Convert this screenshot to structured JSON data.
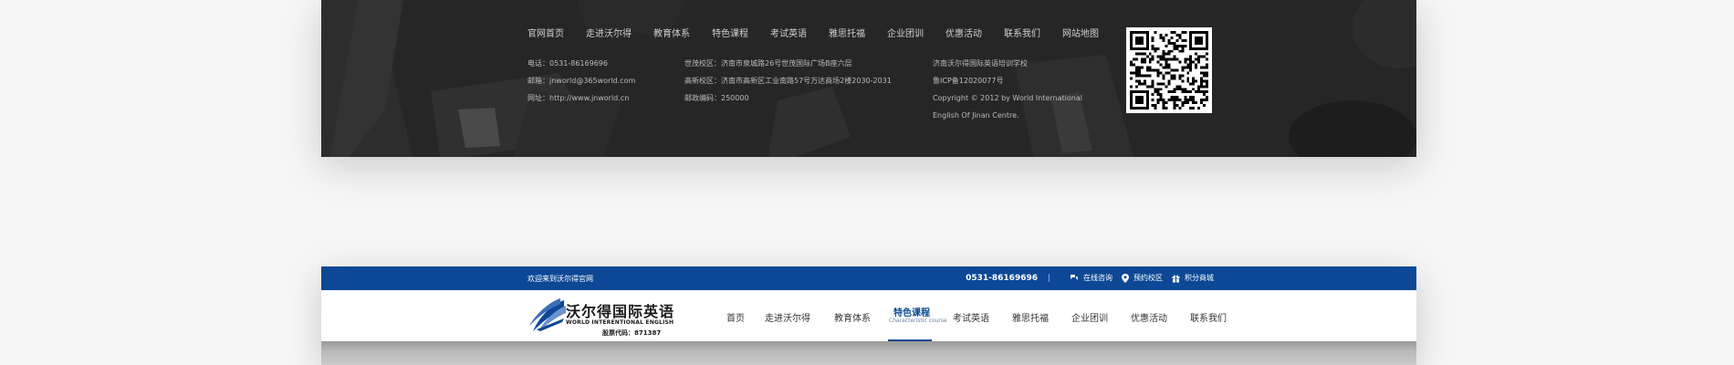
{
  "footer": {
    "nav": [
      "官网首页",
      "走进沃尔得",
      "教育体系",
      "特色课程",
      "考试英语",
      "雅思托福",
      "企业团训",
      "优惠活动",
      "联系我们",
      "网站地图"
    ],
    "contact": {
      "phone": "电话：0531-86169696",
      "email": "邮箱：jnworld@365world.com",
      "website": "网址：http://www.jnworld.cn"
    },
    "campus": {
      "shimao": "世茂校区：济南市泉城路26号世茂国际广场B座六层",
      "gaoxin": "高新校区：济南市高新区工业南路57号万达商场2楼2030-2031",
      "postcode": "邮政编码：250000"
    },
    "company": {
      "name": "济南沃尔得国际英语培训学校",
      "icp": "鲁ICP备12020077号",
      "copyright_1": "Copyright © 2012 by World International",
      "copyright_2": "English Of Jinan Centre."
    }
  },
  "header": {
    "topbar": {
      "welcome": "欢迎来到沃尔得官网",
      "phone": "0531-86169696",
      "links": [
        "在线咨询",
        "预约校区",
        "积分商城"
      ]
    },
    "logo": {
      "brand": "沃尔得国际英语",
      "sub": "WORLD INTERENTIONAL ENGLISH",
      "stock": "股票代码：871387"
    },
    "menu": [
      {
        "label": "首页"
      },
      {
        "label": "走进沃尔得"
      },
      {
        "label": "教育体系"
      },
      {
        "label": "特色课程",
        "en": "Characteristic course",
        "active": true
      },
      {
        "label": "考试英语"
      },
      {
        "label": "雅思托福"
      },
      {
        "label": "企业团训"
      },
      {
        "label": "优惠活动"
      },
      {
        "label": "联系我们"
      }
    ]
  },
  "colors": {
    "primary": "#0c4896",
    "footer_bg": "#262626"
  }
}
